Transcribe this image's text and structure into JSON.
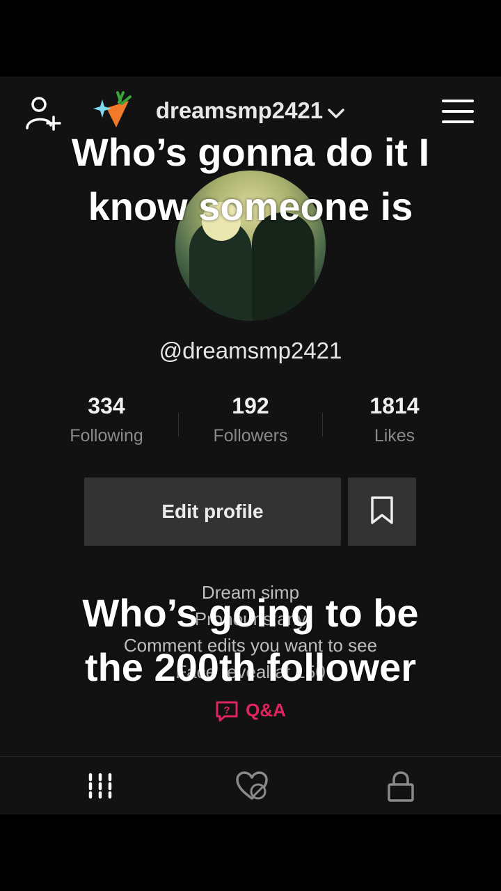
{
  "header": {
    "username": "dreamsmp2421"
  },
  "profile": {
    "handle": "@dreamsmp2421",
    "stats": [
      {
        "value": "334",
        "label": "Following"
      },
      {
        "value": "192",
        "label": "Followers"
      },
      {
        "value": "1814",
        "label": "Likes"
      }
    ],
    "edit_label": "Edit profile",
    "bio": [
      "Dream simp",
      "Pronouns:any",
      "Comment edits you want to see",
      "Face reveal at 150"
    ],
    "qa_label": "Q&A"
  },
  "overlay": {
    "top_line1": "Who’s gonna do it I",
    "top_line2": "know someone is",
    "bottom_line1": "Who’s going to be",
    "bottom_line2": "the 200th follower"
  },
  "colors": {
    "background": "#121212",
    "button": "#333333",
    "accent": "#e0245e"
  },
  "icons": [
    "add-friend-icon",
    "carrot-sparkle-icon",
    "chevron-down-icon",
    "menu-icon",
    "bookmark-icon",
    "qa-icon",
    "grid-icon",
    "liked-hidden-icon",
    "lock-icon"
  ]
}
